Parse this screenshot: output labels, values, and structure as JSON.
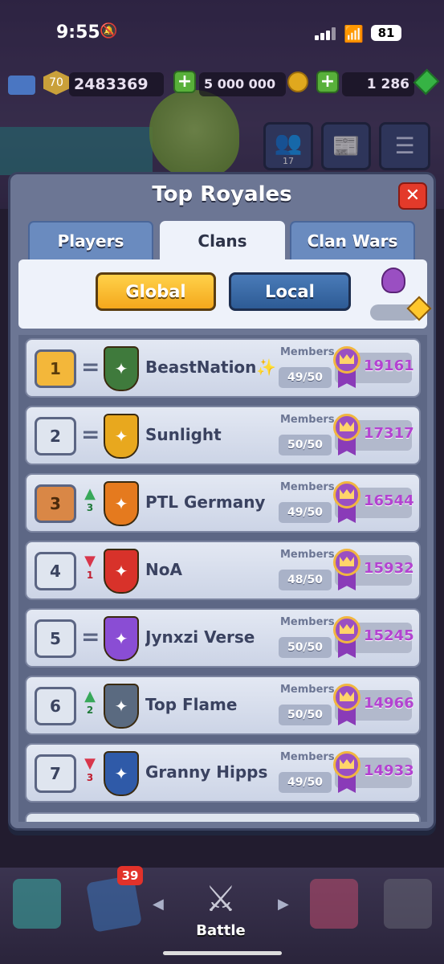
{
  "status": {
    "time": "9:55",
    "battery": "81"
  },
  "resources": {
    "level": "70",
    "trophies": "2483369",
    "gold": "5 000 000",
    "gems": "1 286"
  },
  "home": {
    "friends_count": "17"
  },
  "modal": {
    "title": "Top Royales",
    "tabs": [
      {
        "label": "Players",
        "active": false
      },
      {
        "label": "Clans",
        "active": true
      },
      {
        "label": "Clan Wars",
        "active": false
      }
    ],
    "filters": {
      "global_label": "Global",
      "local_label": "Local",
      "selected": "Global"
    }
  },
  "members_label": "Members",
  "clans": [
    {
      "rank": "1",
      "change_dir": "same",
      "change": "",
      "name": "BeastNation✨",
      "members": "49/50",
      "trophies": "19161",
      "badge_color": "#3f7a3c"
    },
    {
      "rank": "2",
      "change_dir": "same",
      "change": "",
      "name": "Sunlight",
      "members": "50/50",
      "trophies": "17317",
      "badge_color": "#e8a81e"
    },
    {
      "rank": "3",
      "change_dir": "up",
      "change": "3",
      "name": "PTL Germany",
      "members": "49/50",
      "trophies": "16544",
      "badge_color": "#e57a1e"
    },
    {
      "rank": "4",
      "change_dir": "down",
      "change": "1",
      "name": "NoA",
      "members": "48/50",
      "trophies": "15932",
      "badge_color": "#d8322a"
    },
    {
      "rank": "5",
      "change_dir": "same",
      "change": "",
      "name": "Jynxzi Verse",
      "members": "50/50",
      "trophies": "15245",
      "badge_color": "#8a4dd4"
    },
    {
      "rank": "6",
      "change_dir": "up",
      "change": "2",
      "name": "Top Flame",
      "members": "50/50",
      "trophies": "14966",
      "badge_color": "#5a6a80"
    },
    {
      "rank": "7",
      "change_dir": "down",
      "change": "3",
      "name": "Granny Hipps",
      "members": "49/50",
      "trophies": "14933",
      "badge_color": "#2f5aa8"
    }
  ],
  "bottom_nav": {
    "cards_badge": "39",
    "battle_label": "Battle"
  }
}
